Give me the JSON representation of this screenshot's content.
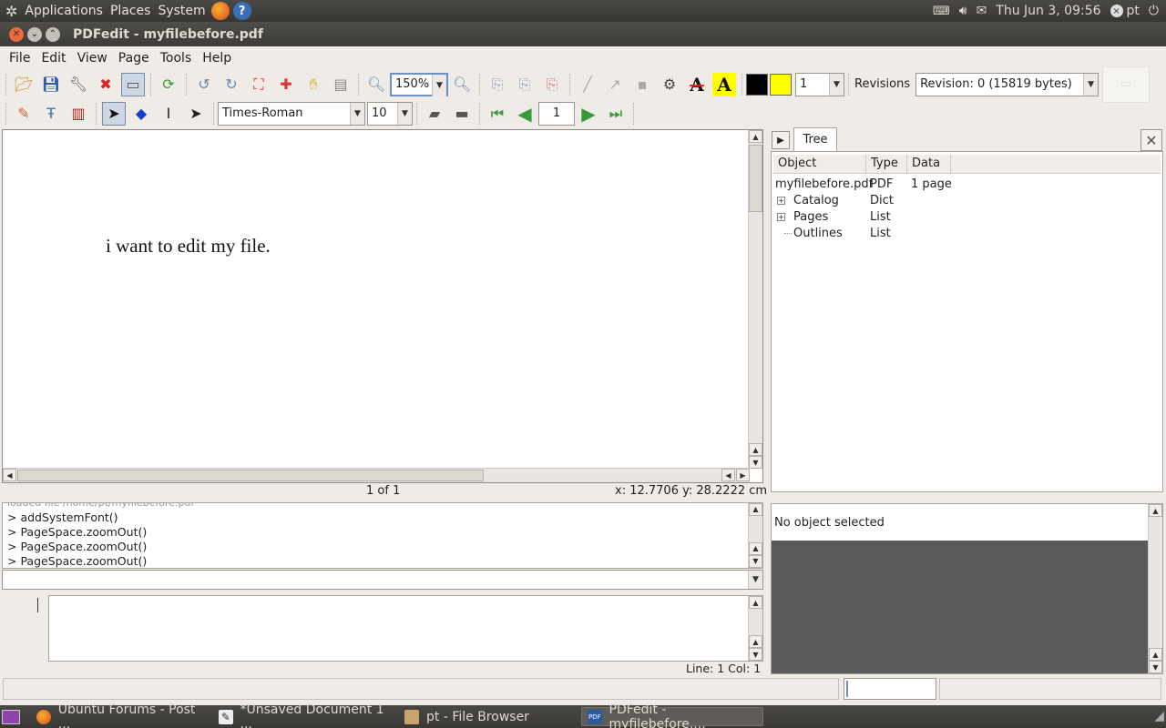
{
  "top_panel": {
    "menus": [
      "Applications",
      "Places",
      "System"
    ],
    "clock": "Thu Jun  3, 09:56",
    "user": "pt"
  },
  "window": {
    "title": "PDFedit - myfilebefore.pdf"
  },
  "menubar": [
    "File",
    "Edit",
    "View",
    "Page",
    "Tools",
    "Help"
  ],
  "toolbar": {
    "zoom_value": "150%",
    "line_width": "1",
    "revisions_label": "Revisions",
    "revision_value": "Revision: 0 (15819 bytes)",
    "font_name": "Times-Roman",
    "font_size": "10",
    "page_number": "1",
    "stroke_color": "#000000",
    "fill_color": "#ffff00"
  },
  "page_view": {
    "text": "i want to edit my file.",
    "page_status": "1 of 1",
    "coords": "x: 12.7706 y: 28.2222 cm"
  },
  "console": {
    "lines": [
      "> addSystemFont()",
      "> PageSpace.zoomOut()",
      "> PageSpace.zoomOut()",
      "> PageSpace.zoomOut()"
    ],
    "line_col": "Line: 1 Col: 1"
  },
  "tree": {
    "tab": "Tree",
    "headers": [
      "Object",
      "Type",
      "Data"
    ],
    "rows": [
      {
        "object": "myfilebefore.pdf",
        "type": "PDF",
        "data": "1 page"
      },
      {
        "object": "Catalog",
        "type": "Dict",
        "data": ""
      },
      {
        "object": "Pages",
        "type": "List",
        "data": ""
      },
      {
        "object": "Outlines",
        "type": "List",
        "data": ""
      }
    ]
  },
  "properties": {
    "status": "No object selected"
  },
  "taskbar": {
    "tasks": [
      "Ubuntu Forums - Post ...",
      "*Unsaved Document 1 ...",
      "pt - File Browser",
      "PDFedit - myfilebefore...."
    ]
  }
}
